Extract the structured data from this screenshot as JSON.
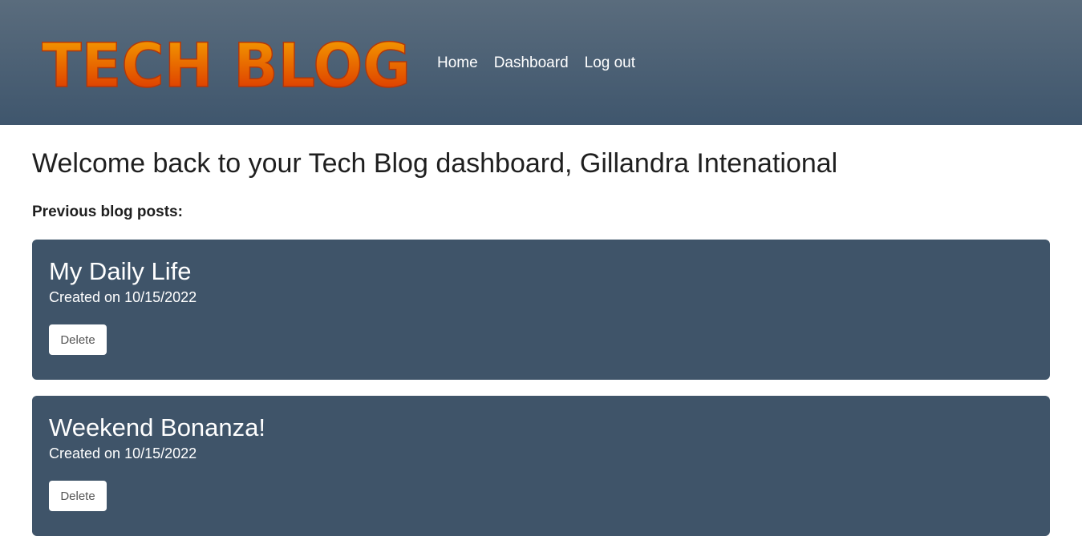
{
  "header": {
    "logo_text": "TECH BLOG",
    "nav": [
      {
        "label": "Home"
      },
      {
        "label": "Dashboard"
      },
      {
        "label": "Log out"
      }
    ]
  },
  "main": {
    "welcome": "Welcome back to your Tech Blog dashboard, Gillandra Intenational",
    "section_label": "Previous blog posts:",
    "posts": [
      {
        "title": "My Daily Life",
        "created_prefix": "Created on",
        "date": "10/15/2022",
        "delete_label": "Delete"
      },
      {
        "title": "Weekend Bonanza!",
        "created_prefix": "Created on",
        "date": "10/15/2022",
        "delete_label": "Delete"
      }
    ]
  },
  "colors": {
    "header_gradient_top": "#5a6c7d",
    "header_gradient_bottom": "#3f566d",
    "card_background": "#3f5469",
    "logo_gradient_top": "#f7a800",
    "logo_gradient_bottom": "#d92a00"
  }
}
